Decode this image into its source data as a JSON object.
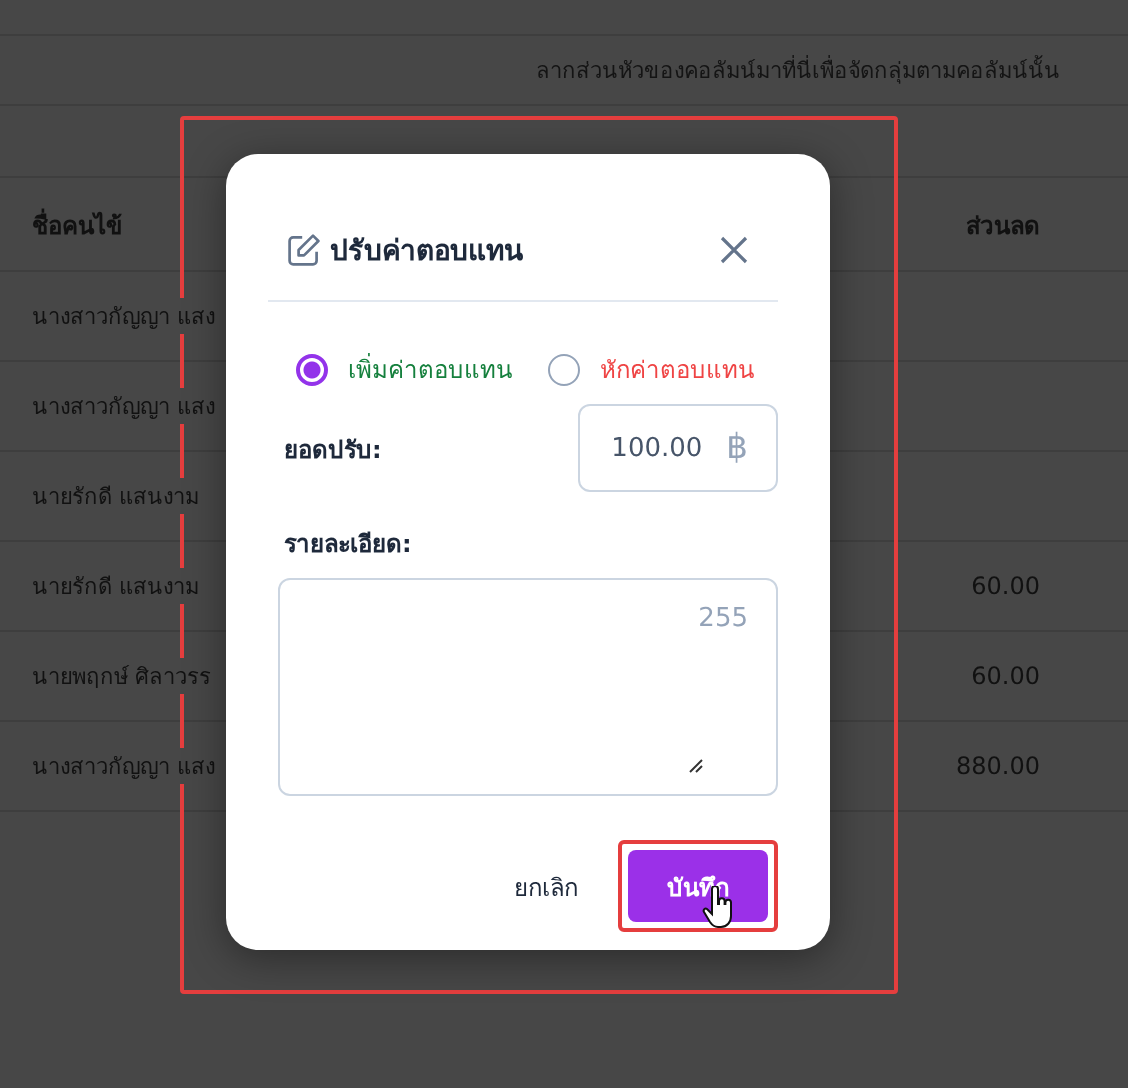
{
  "group_hint": "ลากส่วนหัวของคอลัมน์มาที่นี่เพื่อจัดกลุ่มตามคอลัมน์นั้น",
  "table": {
    "columns": [
      "ชื่อคนไข้",
      "ส่วนลด"
    ],
    "rows": [
      {
        "name": "นางสาวกัญญา แสง",
        "discount": ""
      },
      {
        "name": "นางสาวกัญญา แสง",
        "discount": ""
      },
      {
        "name": "นายรักดี แสนงาม",
        "discount": ""
      },
      {
        "name": "นายรักดี แสนงาม",
        "discount": "60.00"
      },
      {
        "name": "นายพฤกษ์  ศิลาวรร",
        "discount": "60.00"
      },
      {
        "name": "นางสาวกัญญา แสง",
        "discount": "880.00"
      }
    ]
  },
  "dialog": {
    "title": "ปรับค่าตอบแทน",
    "options": [
      {
        "label": "เพิ่มค่าตอบแทน",
        "selected": true,
        "color": "#15803d"
      },
      {
        "label": "หักค่าตอบแทน",
        "selected": false,
        "color": "#ef4444"
      }
    ],
    "amount_label": "ยอดปรับ:",
    "amount_value": "100.00",
    "currency": "฿",
    "detail_label": "รายละเอียด:",
    "detail_counter": "255",
    "cancel": "ยกเลิก",
    "save": "บันทึก"
  }
}
